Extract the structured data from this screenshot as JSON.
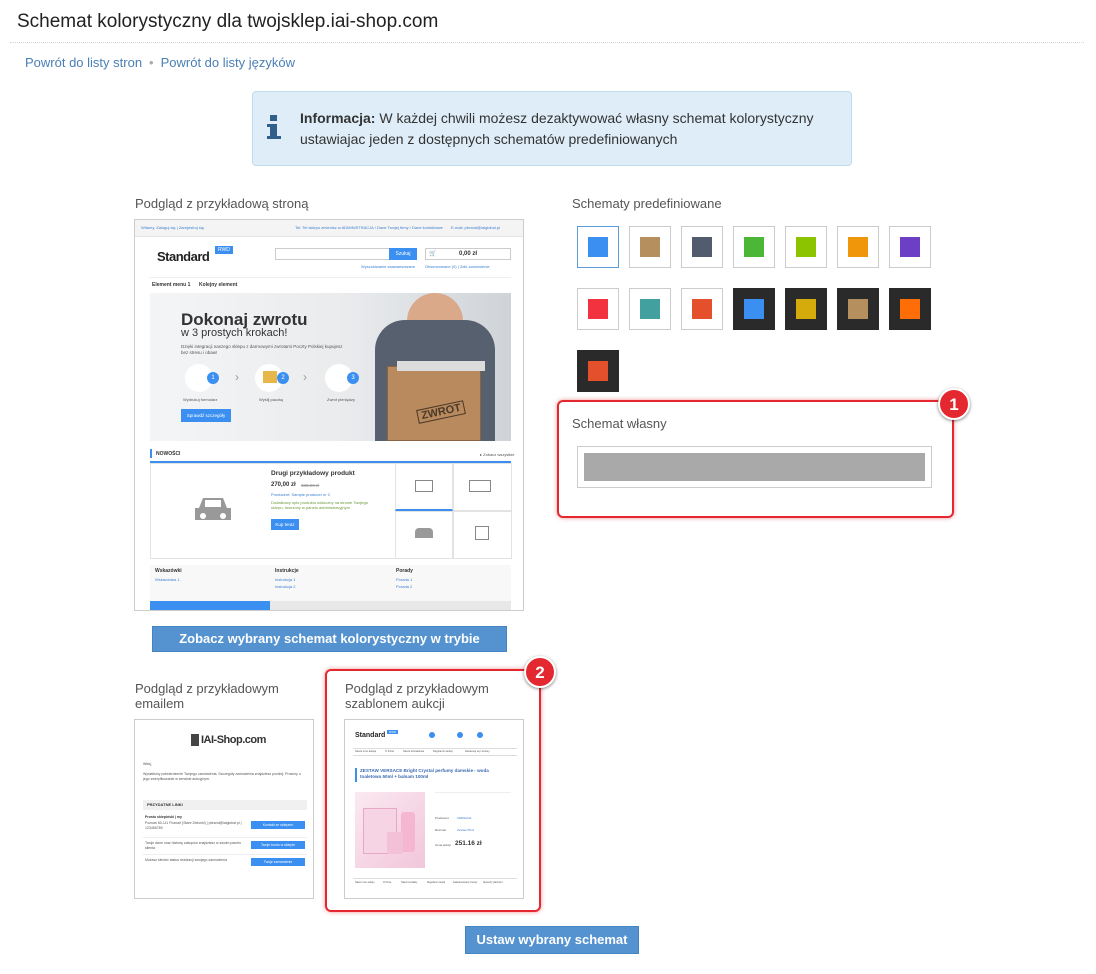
{
  "page": {
    "title": "Schemat kolorystyczny dla twojsklep.iai-shop.com"
  },
  "breadcrumb": {
    "back_to_pages": "Powrót do listy stron",
    "separator": "•",
    "back_to_languages": "Powrót do listy języków"
  },
  "info": {
    "icon": "info-icon",
    "label": "Informacja:",
    "text": "W każdej chwili możesz dezaktywować własny schemat kolorystyczny ustawiajac jeden z dostępnych schematów predefiniowanych"
  },
  "shop_preview": {
    "label": "Podgląd z przykładową stroną",
    "button": "Zobacz wybrany schemat kolorystyczny w trybie podglądu",
    "mock": {
      "top_left": "Witamy, Zaloguj się | Zarejestruj się",
      "top_middle": "Tel: Tel sklepu zmienisz w ADMINISTRACJA / Dane Twojej firmy / Dane kontaktowe",
      "top_right": "E-mail: pbrand@iaiglobal.pl",
      "logo": "Standard",
      "logo_badge": "RWD",
      "search_button": "Szukaj",
      "cart_value": "0,00 zł",
      "advanced_search": "Wyszukiwanie zaawansowane",
      "favourites": "Obserwowane (0) | Zdić zamówienie",
      "menu_1": "Element menu 1",
      "menu_2": "Kolejny element",
      "hero_title": "Dokonaj zwrotu",
      "hero_subtitle": "w 3 prostych krokach!",
      "hero_text": "Dzięki integracji naszego sklepu z darmowymi zwrotami Poczty Polskiej kupujesz bez stresu i obaw!",
      "step_1": "Wydrukuj formularz",
      "step_2": "Wyślij paczkę",
      "step_3": "Zwrot pieniędzy",
      "hero_button": "Sprawdź szczegóły",
      "box_label": "ZWROT",
      "news_label": "NOWOŚCI",
      "see_all": "▸ Zobacz wszystkie",
      "product_name": "Drugi przykładowy produkt",
      "product_price": "270,00 zł",
      "product_old_price": "333,00 zł",
      "producer": "Producent: Sample producer nr 2",
      "product_desc": "Dodatkowy opis produktu widoczny na stronie Twojego sklepu, tworzony w panelu administracyjnym",
      "buy_button": "Kup teraz",
      "footer_col_1": "Wskazówki",
      "footer_col_1_link": "Wskazówka 1",
      "footer_col_2": "Instrukcje",
      "footer_col_2_link_1": "Instrukcja 1",
      "footer_col_2_link_2": "Instrukcja 2",
      "footer_col_3": "Porady",
      "footer_col_3_link_1": "Porada 1",
      "footer_col_3_link_2": "Porada 2"
    }
  },
  "email_preview": {
    "label": "Podgląd z przykładowym emailem",
    "mock": {
      "logo": "IAI-Shop.com",
      "greeting": "Witaj,",
      "intro": "Wysłaliśmy potwierdzenie Twojego zamówienia. Szczegóły zamówienia znajdziesz poniżej. Prosimy o jego zweryfikowanie w serwisie aukcyjnym.",
      "links_header": "PRZYDATNE LINKI",
      "contact_name": "Prosto sklepiński | my",
      "contact_address": "Poznań 60-111 Poznań (Stare Zielonki) | pbrand@iaiglobal.pl | 123456789",
      "button_1": "Kontakt ze sklepem",
      "text_2": "Twoje dane oraz historię zakupów znajdziesz w swoim panelu klienta",
      "button_2": "Twoje konto w sklepie",
      "text_3": "Możesz śledzić status realizacji swojego zamówienia",
      "button_3": "Twoje zamówienie"
    }
  },
  "auction_preview": {
    "label": "Podgląd z przykładowym szablonem aukcji",
    "mock": {
      "logo": "Standard",
      "logo_badge": "RWD",
      "nav": [
        "Nasze inne aukcje",
        "O firmie",
        "Nasze kontaktowe",
        "Regulamin aukcji",
        "Zawansuj są i wniosy"
      ],
      "product_title": "ZESTAW VERSACE Bright Crystal perfumy damskie - woda toaletowa 50ml + balsam 100ml",
      "row_1_label": "Producent",
      "row_1_value": "VERSACE",
      "row_2_label": "Rozmiar",
      "row_2_value": "Zestaw 50ml",
      "price_label": "Cena aukcji",
      "price": "251.16 zł",
      "footer": [
        "Nasze inne aukcje",
        "O firmie",
        "Nasze kontakty",
        "Regulamin aukcji",
        "Zaawansowany zwroty",
        "Sposoby płatności"
      ]
    }
  },
  "schemes": {
    "label": "Schematy predefiniowane",
    "selected_index": 0,
    "colors": [
      "#3a8ff1",
      "#b58f5e",
      "#525c6f",
      "#4cb637",
      "#8dc400",
      "#f0960a",
      "#6c3fc4",
      "#f2323e",
      "#42a09e",
      "#e4502b",
      "#3a8ff1",
      "#d4ab0a",
      "#b58f5e",
      "#ff6e06",
      "#e4502b"
    ],
    "dark_frames": [
      false,
      false,
      false,
      false,
      false,
      false,
      false,
      false,
      false,
      false,
      true,
      true,
      true,
      true,
      true
    ]
  },
  "custom_scheme": {
    "label": "Schemat własny",
    "badge": "1"
  },
  "auction_badge": "2",
  "set_button": "Ustaw wybrany schemat"
}
